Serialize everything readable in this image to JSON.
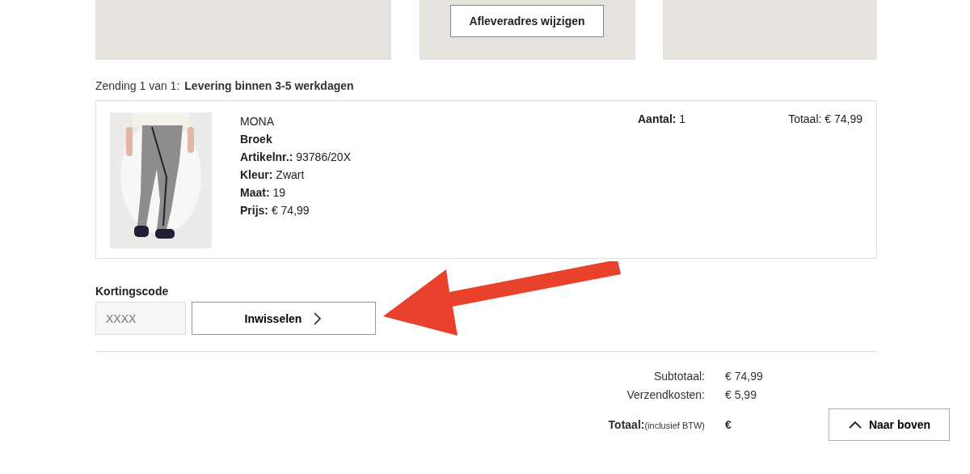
{
  "address_panels": [
    {
      "kind": "blank"
    },
    {
      "kind": "action",
      "button": "Afleveradres wijzigen"
    },
    {
      "kind": "blank"
    }
  ],
  "shipment": {
    "label": "Zending 1 van 1:",
    "delivery": "Levering binnen 3-5 werkdagen"
  },
  "item": {
    "brand": "MONA",
    "name": "Broek",
    "details": [
      {
        "label": "Artikelnr.:",
        "value": "93786/20X"
      },
      {
        "label": "Kleur:",
        "value": "Zwart"
      },
      {
        "label": "Maat:",
        "value": "19"
      },
      {
        "label": "Prijs:",
        "value": "€ 74,99"
      }
    ],
    "quantity_label": "Aantal:",
    "quantity": "1",
    "total": "Totaal: € 74,99"
  },
  "discount": {
    "label": "Kortingscode",
    "placeholder": "XXXX",
    "button": "Inwisselen"
  },
  "summary": [
    {
      "label": "Subtotaal:",
      "value": "€ 74,99"
    },
    {
      "label": "Verzendkosten:",
      "value": "€ 5,99"
    }
  ],
  "grand_total": {
    "label": "Totaal:",
    "note": "(inclusief BTW)",
    "value": "€"
  },
  "back_to_top": "Naar boven"
}
